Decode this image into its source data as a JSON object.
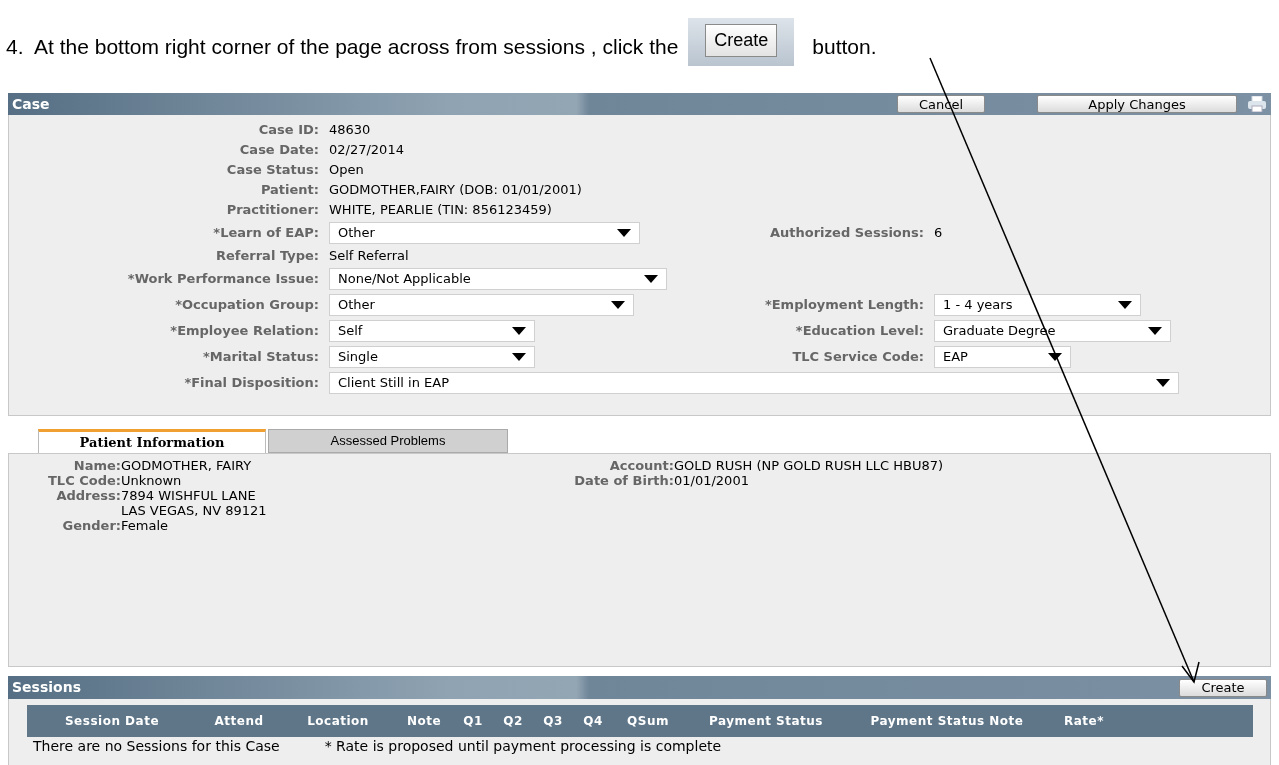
{
  "instruction": {
    "step": "4.",
    "before": "At the bottom right corner of the page across from sessions , click the",
    "button": "Create",
    "after": "button."
  },
  "case_panel": {
    "title": "Case",
    "buttons": [
      "Cancel",
      "Apply Changes"
    ],
    "rows": [
      {
        "left": {
          "label": "Case ID:",
          "value": "48630",
          "kind": "text"
        }
      },
      {
        "left": {
          "label": "Case Date:",
          "value": "02/27/2014",
          "kind": "text"
        }
      },
      {
        "left": {
          "label": "Case Status:",
          "value": "Open",
          "kind": "text"
        }
      },
      {
        "left": {
          "label": "Patient:",
          "value": "GODMOTHER,FAIRY (DOB: 01/01/2001)",
          "kind": "text"
        }
      },
      {
        "left": {
          "label": "Practitioner:",
          "value": "WHITE, PEARLIE (TIN: 856123459)",
          "kind": "text"
        }
      },
      {
        "left": {
          "label": "*Learn of EAP:",
          "value": "Other",
          "kind": "select"
        },
        "right": {
          "label": "Authorized Sessions:",
          "value": "6",
          "kind": "text"
        }
      },
      {
        "left": {
          "label": "Referral Type:",
          "value": "Self Referral",
          "kind": "text"
        }
      },
      {
        "left": {
          "label": "*Work Performance Issue:",
          "value": "None/Not Applicable",
          "kind": "select"
        }
      },
      {
        "left": {
          "label": "*Occupation Group:",
          "value": "Other",
          "kind": "select"
        },
        "right": {
          "label": "*Employment Length:",
          "value": "1 - 4 years",
          "kind": "select"
        }
      },
      {
        "left": {
          "label": "*Employee Relation:",
          "value": "Self",
          "kind": "select"
        },
        "right": {
          "label": "*Education Level:",
          "value": "Graduate Degree",
          "kind": "select"
        }
      },
      {
        "left": {
          "label": "*Marital Status:",
          "value": "Single",
          "kind": "select"
        },
        "right": {
          "label": "TLC Service Code:",
          "value": "EAP",
          "kind": "select"
        }
      },
      {
        "left": {
          "label": "*Final Disposition:",
          "value": "Client Still in EAP",
          "kind": "select"
        }
      }
    ]
  },
  "tabs": [
    {
      "label": "Patient Information",
      "selected": true
    },
    {
      "label": "Assessed Problems",
      "selected": false
    }
  ],
  "patient_info": {
    "left": [
      {
        "label": "Name:",
        "value": [
          "GODMOTHER, FAIRY"
        ]
      },
      {
        "label": "TLC Code:",
        "value": [
          "Unknown"
        ]
      },
      {
        "label": "Address:",
        "value": [
          "7894 WISHFUL LANE",
          "LAS VEGAS, NV 89121"
        ]
      },
      {
        "label": "Gender:",
        "value": [
          "Female"
        ]
      }
    ],
    "right": [
      {
        "label": "Account:",
        "value": [
          "GOLD RUSH (NP GOLD RUSH LLC HBU87)"
        ]
      },
      {
        "label": "Date of Birth:",
        "value": [
          "01/01/2001"
        ]
      }
    ]
  },
  "sessions": {
    "title": "Sessions",
    "button": "Create",
    "columns": [
      "Session Date",
      "Attend",
      "Location",
      "Note",
      "Q1",
      "Q2",
      "Q3",
      "Q4",
      "QSum",
      "Payment Status",
      "Payment Status Note",
      "Rate*"
    ],
    "empty_message": "There are no Sessions for this Case",
    "footnote": "* Rate is proposed until payment processing is complete"
  }
}
